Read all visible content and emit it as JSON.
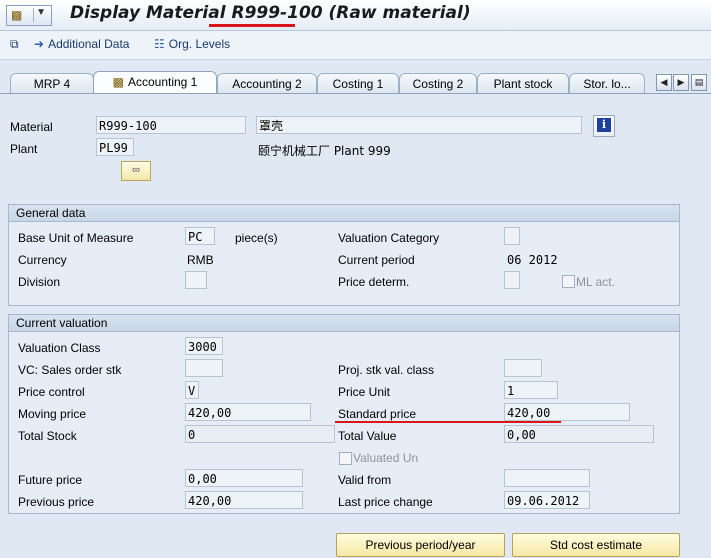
{
  "window": {
    "title_prefix": "Display Material ",
    "title_material": "R999-100",
    "title_suffix": " (Raw material)"
  },
  "toolbar": {
    "additional_data": "Additional Data",
    "org_levels": "Org. Levels"
  },
  "tabs": [
    {
      "label": "MRP 4"
    },
    {
      "label": "Accounting 1",
      "active": true
    },
    {
      "label": "Accounting 2"
    },
    {
      "label": "Costing 1"
    },
    {
      "label": "Costing 2"
    },
    {
      "label": "Plant stock"
    },
    {
      "label": "Stor. lo..."
    }
  ],
  "header": {
    "material_label": "Material",
    "material_value": "R999-100",
    "material_desc": "罩壳",
    "plant_label": "Plant",
    "plant_value": "PL99",
    "plant_desc": "颐宁机械工厂 Plant 999"
  },
  "general_data": {
    "title": "General data",
    "base_uom_label": "Base Unit of Measure",
    "base_uom_value": "PC",
    "base_uom_text": "piece(s)",
    "valuation_category_label": "Valuation Category",
    "valuation_category_value": "",
    "currency_label": "Currency",
    "currency_value": "RMB",
    "current_period_label": "Current period",
    "current_period_value": "06 2012",
    "division_label": "Division",
    "division_value": "",
    "price_determ_label": "Price determ.",
    "price_determ_value": "",
    "ml_act_label": "ML act."
  },
  "current_valuation": {
    "title": "Current valuation",
    "valuation_class_label": "Valuation Class",
    "valuation_class_value": "3000",
    "vc_sales_label": "VC: Sales order stk",
    "vc_sales_value": "",
    "proj_stk_label": "Proj. stk val. class",
    "proj_stk_value": "",
    "price_control_label": "Price control",
    "price_control_value": "V",
    "price_unit_label": "Price Unit",
    "price_unit_value": "1",
    "moving_price_label": "Moving price",
    "moving_price_value": "420,00",
    "standard_price_label": "Standard price",
    "standard_price_value": "420,00",
    "total_stock_label": "Total Stock",
    "total_stock_value": "0",
    "total_value_label": "Total Value",
    "total_value_value": "0,00",
    "valuated_un_label": "Valuated Un",
    "future_price_label": "Future price",
    "future_price_value": "0,00",
    "valid_from_label": "Valid from",
    "valid_from_value": "",
    "previous_price_label": "Previous price",
    "previous_price_value": "420,00",
    "last_price_change_label": "Last price change",
    "last_price_change_value": "09.06.2012"
  },
  "buttons": {
    "previous_period": "Previous period/year",
    "std_cost_estimate": "Std cost estimate"
  },
  "colors": {
    "highlight_red": "#d9161b",
    "background": "#dfe8f3"
  }
}
